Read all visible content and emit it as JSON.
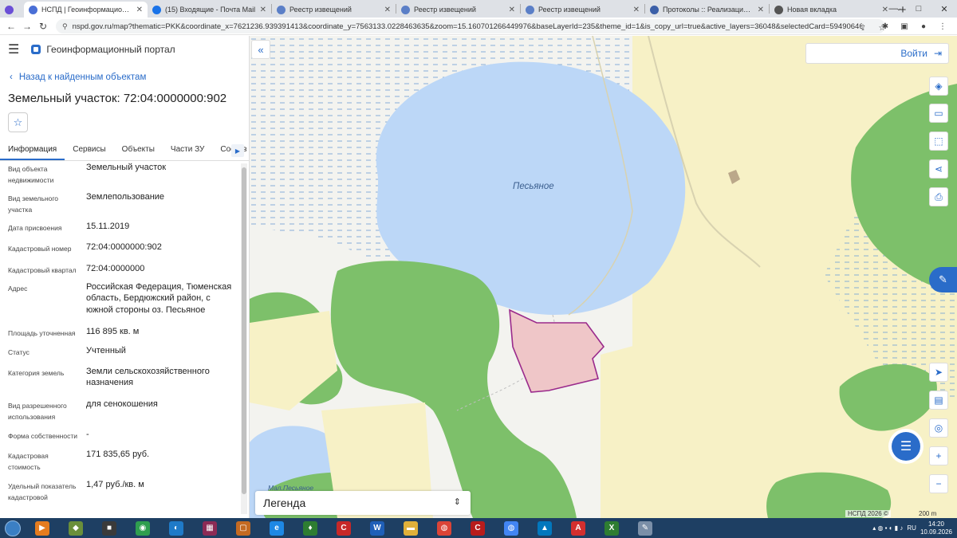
{
  "browser": {
    "tabs": [
      {
        "title": "НСПД | Геоинформационный п",
        "favicon_color": "#4a6fd6",
        "active": true
      },
      {
        "title": "(15) Входящие - Почта Mail",
        "favicon_color": "#1a73e8",
        "active": false
      },
      {
        "title": "Реестр извещений",
        "favicon_color": "#5b7fc7",
        "active": false
      },
      {
        "title": "Реестр извещений",
        "favicon_color": "#5b7fc7",
        "active": false
      },
      {
        "title": "Реестр извещений",
        "favicon_color": "#5b7fc7",
        "active": false
      },
      {
        "title": "Протоколы :: Реализация госи",
        "favicon_color": "#3b5fa8",
        "active": false
      },
      {
        "title": "Новая вкладка",
        "favicon_color": "#555555",
        "active": false
      }
    ],
    "url": "nspd.gov.ru/map?thematic=PKK&coordinate_x=7621236.939391413&coordinate_y=7563133.0228463635&zoom=15.160701266449976&baseLayerId=235&theme_id=1&is_copy_url=true&active_layers=36048&selectedCard=59490646%2C36368%2C72..."
  },
  "portal": {
    "title": "Геоинформационный портал",
    "back_label": "Назад к найденным объектам",
    "parcel_title": "Земельный участок: 72:04:0000000:902"
  },
  "info_tabs": [
    "Информация",
    "Сервисы",
    "Объекты",
    "Части ЗУ",
    "Состав"
  ],
  "attributes": [
    {
      "label": "Вид объекта недвижимости",
      "value": "Земельный участок"
    },
    {
      "label": "Вид земельного участка",
      "value": "Землепользование"
    },
    {
      "label": "Дата присвоения",
      "value": "15.11.2019"
    },
    {
      "label": "Кадастровый номер",
      "value": "72:04:0000000:902"
    },
    {
      "label": "Кадастровый квартал",
      "value": "72:04:0000000"
    },
    {
      "label": "Адрес",
      "value": "Российская Федерация, Тюменская область, Бердюжский район, с южной стороны оз. Песьяное"
    },
    {
      "label": "Площадь уточненная",
      "value": "116 895 кв. м"
    },
    {
      "label": "Статус",
      "value": "Учтенный"
    },
    {
      "label": "Категория земель",
      "value": "Земли сельскохозяйственного назначения"
    },
    {
      "label": "Вид разрешенного использования",
      "value": "для сенокошения"
    },
    {
      "label": "Форма собственности",
      "value": "-"
    },
    {
      "label": "Кадастровая стоимость",
      "value": "171 835,65 руб."
    },
    {
      "label": "Удельный показатель кадастровой",
      "value": "1,47 руб./кв. м"
    }
  ],
  "map": {
    "login_label": "Войти",
    "lake_label": "Песьяное",
    "small_lake_label": "Мал.Песьяное",
    "legend_label": "Легенда",
    "attribution": "НСПД 2026 ©",
    "scale_label": "200 m",
    "colors": {
      "water": "#bcd7f7",
      "forest": "#7dc06a",
      "field": "#f7f1c6",
      "parcel_fill": "#efc6c8",
      "parcel_border": "#9a2a8c",
      "accent": "#2a6cc9"
    }
  },
  "taskbar": {
    "time": "14:20",
    "date": "10.09.2026",
    "language": "RU"
  }
}
